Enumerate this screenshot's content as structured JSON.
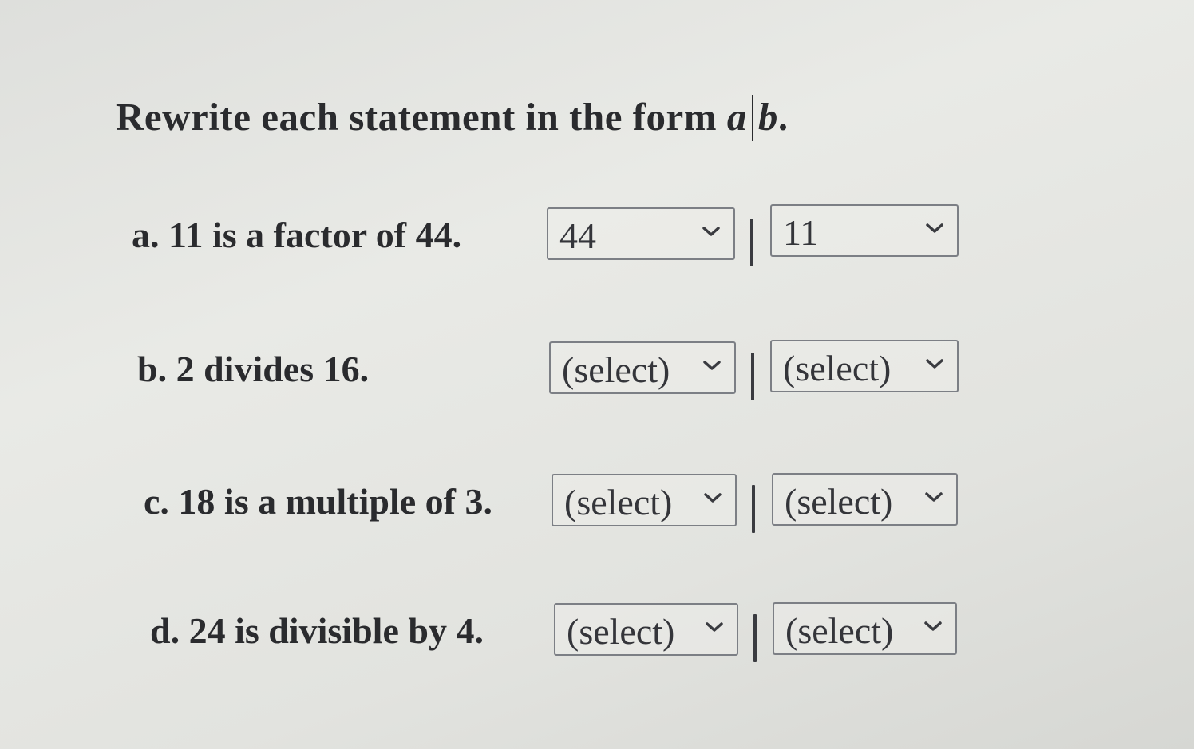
{
  "title": {
    "text": "Rewrite each statement in the form ",
    "var_a": "a",
    "var_b": "b",
    "end": "."
  },
  "rows": [
    {
      "statement": "a. 11 is a factor of 44.",
      "left_value": "44",
      "right_value": "11"
    },
    {
      "statement": "b. 2 divides 16.",
      "left_value": "(select)",
      "right_value": "(select)"
    },
    {
      "statement": "c. 18 is a multiple of 3.",
      "left_value": "(select)",
      "right_value": "(select)"
    },
    {
      "statement": "d. 24 is divisible by 4.",
      "left_value": "(select)",
      "right_value": "(select)"
    }
  ],
  "icons": {
    "dropdown": "chevron-down-icon"
  }
}
